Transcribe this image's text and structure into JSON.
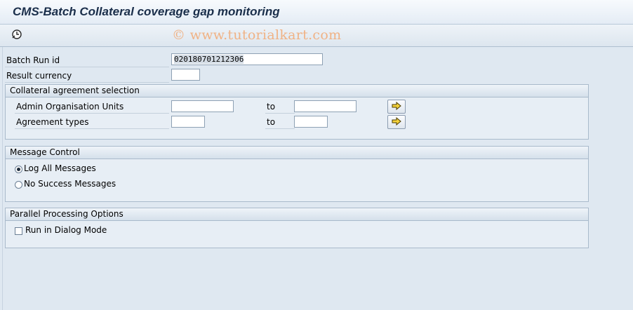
{
  "window": {
    "title": "CMS-Batch Collateral coverage gap monitoring"
  },
  "toolbar": {
    "execute_icon": "execute-clock-icon",
    "watermark": "© www.tutorialkart.com"
  },
  "fields": {
    "batch_run_id": {
      "label": "Batch Run id",
      "value": "020180701212306"
    },
    "result_currency": {
      "label": "Result currency",
      "value": ""
    }
  },
  "collateral_selection": {
    "title": "Collateral agreement selection",
    "admin_org_units": {
      "label": "Admin Organisation Units",
      "from": "",
      "to_label": "to",
      "to": ""
    },
    "agreement_types": {
      "label": "Agreement types",
      "from": "",
      "to_label": "to",
      "to": ""
    },
    "multi_select_icon": "arrow-right-icon"
  },
  "message_control": {
    "title": "Message Control",
    "options": [
      {
        "label": "Log All Messages",
        "selected": true
      },
      {
        "label": "No Success Messages",
        "selected": false
      }
    ]
  },
  "parallel_processing": {
    "title": "Parallel Processing Options",
    "run_in_dialog_mode": {
      "label": "Run in Dialog Mode",
      "checked": false
    }
  },
  "colors": {
    "background": "#dfe8f1",
    "group_border": "#a9bacb",
    "title_text": "#1a2e4a",
    "watermark": "#f0b285"
  }
}
